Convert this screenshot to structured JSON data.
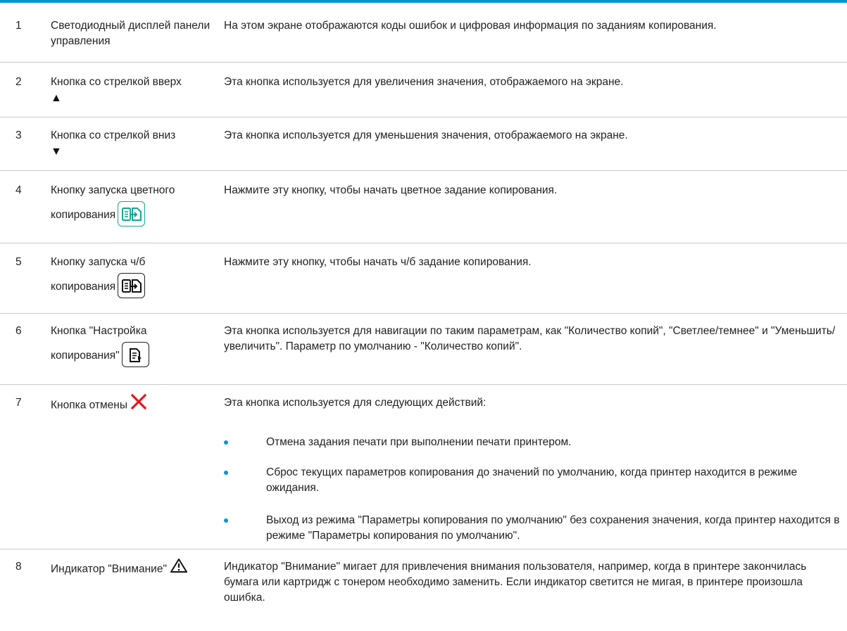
{
  "rows": [
    {
      "num": "1",
      "name": "Светодиодный дисплей панели управления",
      "desc": "На этом экране отображаются коды ошибок и цифровая информация по заданиям копирования."
    },
    {
      "num": "2",
      "name": "Кнопка со стрелкой вверх",
      "glyph": "▲",
      "desc": "Эта кнопка используется для увеличения значения, отображаемого на экране."
    },
    {
      "num": "3",
      "name": "Кнопка со стрелкой вниз",
      "glyph": "▼",
      "desc": "Эта кнопка используется для уменьшения значения, отображаемого на экране."
    },
    {
      "num": "4",
      "name_line1": "Кнопку запуска цветного",
      "name_line2": "копирования",
      "icon": "color-copy-start-icon",
      "desc": "Нажмите эту кнопку, чтобы начать цветное задание копирования."
    },
    {
      "num": "5",
      "name_line1": "Кнопку запуска ч/б",
      "name_line2": "копирования",
      "icon": "mono-copy-start-icon",
      "desc": "Нажмите эту кнопку, чтобы начать ч/б задание копирования."
    },
    {
      "num": "6",
      "name_line1": "Кнопка \"Настройка",
      "name_line2": "копирования\"",
      "icon": "copy-setup-icon",
      "desc": "Эта кнопка используется для навигации по таким параметрам, как \"Количество копий\", \"Светлее/темнее\" и \"Уменьшить/увеличить\". Параметр по умолчанию - \"Количество копий\"."
    },
    {
      "num": "7",
      "name": "Кнопка отмены",
      "icon": "cancel-x-icon",
      "desc": "Эта кнопка используется для следующих действий:",
      "bullets": [
        "Отмена задания печати при выполнении печати принтером.",
        "Сброс текущих параметров копирования до значений по умолчанию, когда принтер находится в режиме ожидания.",
        "Выход из режима \"Параметры копирования по умолчанию\" без сохранения значения, когда принтер находится в режиме \"Параметры копирования по умолчанию\"."
      ]
    },
    {
      "num": "8",
      "name": "Индикатор \"Внимание\"",
      "icon": "attention-warning-icon",
      "desc": "Индикатор \"Внимание\" мигает для привлечения внимания пользователя, например, когда в принтере закончилась бумага или картридж с тонером необходимо заменить. Если индикатор светится не мигая, в принтере произошла ошибка."
    }
  ],
  "colors": {
    "accent": "#0096d6",
    "cancel": "#e1191e",
    "color_copy": "#14a88f",
    "separator": "#c9c9c9"
  }
}
